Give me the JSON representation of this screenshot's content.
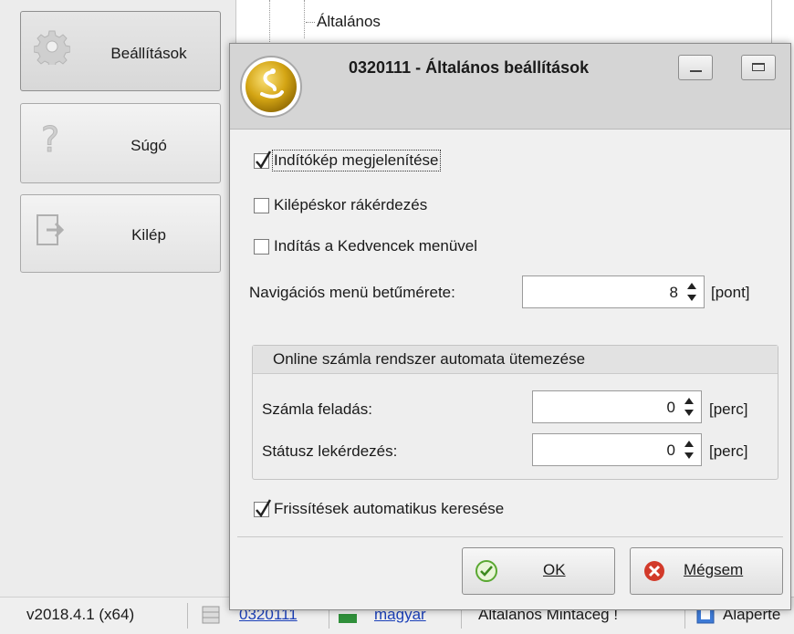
{
  "sidebar": {
    "items": [
      {
        "label": "Beállítások",
        "icon": "gear-icon"
      },
      {
        "label": "Súgó",
        "icon": "help-icon"
      },
      {
        "label": "Kilép",
        "icon": "exit-icon"
      }
    ]
  },
  "tree": {
    "visible_item": "Általános"
  },
  "statusbar": {
    "version": "v2018.4.1 (x64)",
    "user_link": "0320111",
    "language_link": "magyar",
    "company": "Általános Mintacég !",
    "extra": "Alaperté"
  },
  "dialog": {
    "title": "0320111 - Általános beállítások",
    "checkboxes": [
      {
        "label": "Indítókép megjelenítése",
        "checked": true
      },
      {
        "label": "Kilépéskor rákérdezés",
        "checked": false
      },
      {
        "label": "Indítás a Kedvencek menüvel",
        "checked": false
      }
    ],
    "nav_font": {
      "label": "Navigációs menü betűmérete:",
      "value": "8",
      "unit": "[pont]"
    },
    "online_group": {
      "title": "Online számla rendszer automata ütemezése",
      "invoice_send": {
        "label": "Számla feladás:",
        "value": "0",
        "unit": "[perc]"
      },
      "status_query": {
        "label": "Státusz lekérdezés:",
        "value": "0",
        "unit": "[perc]"
      }
    },
    "auto_update": {
      "label": "Frissítések automatikus keresése",
      "checked": true
    },
    "ok_label": "OK",
    "cancel_label": "Mégsem"
  },
  "colors": {
    "accent_gold": "#d4a514",
    "link": "#1a3fb8",
    "cancel_red": "#d23a2a",
    "ok_green": "#5aa832"
  }
}
